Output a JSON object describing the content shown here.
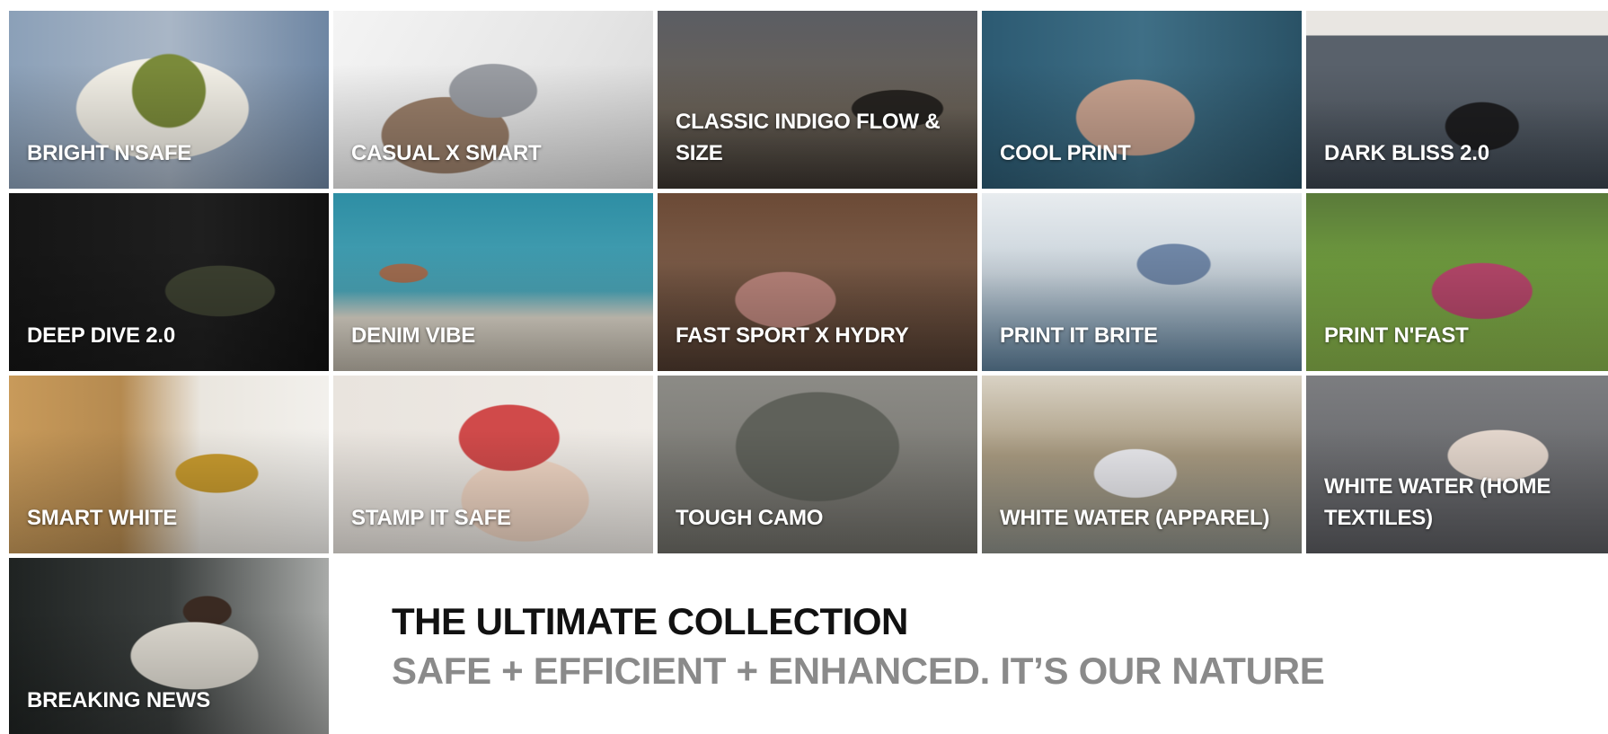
{
  "collection_tiles": [
    {
      "label": "BRIGHT N'SAFE"
    },
    {
      "label": "CASUAL X SMART"
    },
    {
      "label": "CLASSIC INDIGO FLOW & SIZE"
    },
    {
      "label": "COOL PRINT"
    },
    {
      "label": "DARK BLISS 2.0"
    },
    {
      "label": "DEEP DIVE 2.0"
    },
    {
      "label": "DENIM VIBE"
    },
    {
      "label": "FAST SPORT X HYDRY"
    },
    {
      "label": "PRINT IT BRITE"
    },
    {
      "label": "PRINT N'FAST"
    },
    {
      "label": "SMART WHITE"
    },
    {
      "label": "STAMP IT SAFE"
    },
    {
      "label": "TOUGH CAMO"
    },
    {
      "label": "WHITE WATER (APPAREL)"
    },
    {
      "label": "WHITE WATER (HOME TEXTILES)"
    },
    {
      "label": "BREAKING NEWS"
    }
  ],
  "tagline": {
    "headline": "THE ULTIMATE COLLECTION",
    "subline": "SAFE + EFFICIENT + ENHANCED. IT’S OUR NATURE"
  },
  "colors": {
    "headline": "#111111",
    "subline": "#8a8a8a",
    "tile_label": "#ffffff",
    "background": "#ffffff"
  }
}
